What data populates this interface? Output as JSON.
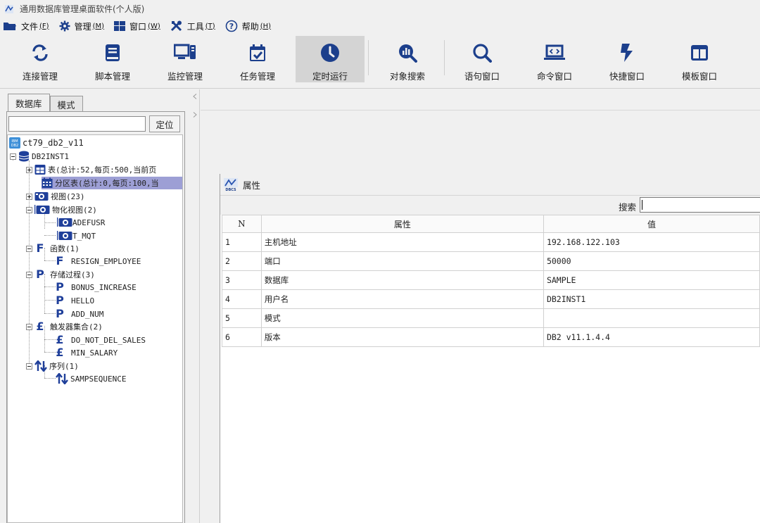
{
  "window": {
    "title": "通用数据库管理桌面软件(个人版)"
  },
  "menu": [
    {
      "label": "文件",
      "key": "(F)",
      "icon": "folder-icon"
    },
    {
      "label": "管理",
      "key": "(M)",
      "icon": "gear-icon"
    },
    {
      "label": "窗口",
      "key": "(W)",
      "icon": "windows-icon"
    },
    {
      "label": "工具",
      "key": "(T)",
      "icon": "tools-icon"
    },
    {
      "label": "帮助",
      "key": "(H)",
      "icon": "help-icon"
    }
  ],
  "toolbar": [
    {
      "label": "连接管理",
      "icon": "sync-icon"
    },
    {
      "label": "脚本管理",
      "icon": "book-icon"
    },
    {
      "label": "监控管理",
      "icon": "monitor-icon"
    },
    {
      "label": "任务管理",
      "icon": "calendar-check-icon"
    },
    {
      "label": "定时运行",
      "icon": "clock-icon",
      "active": true
    },
    {
      "label": "对象搜索",
      "icon": "chart-search-icon"
    },
    {
      "label": "语句窗口",
      "icon": "search-icon"
    },
    {
      "label": "命令窗口",
      "icon": "laptop-code-icon"
    },
    {
      "label": "快捷窗口",
      "icon": "bolt-icon"
    },
    {
      "label": "模板窗口",
      "icon": "columns-icon"
    }
  ],
  "left": {
    "tabs": [
      "数据库",
      "模式"
    ],
    "locate_button": "定位",
    "tree": {
      "root": "ct79_db2_v11",
      "instance": "DB2INST1",
      "tables": "表(总计:52,每页:500,当前页",
      "partition_tables": "分区表(总计:0,每页:100,当",
      "views": "视图(23)",
      "mviews": "物化视图(2)",
      "mview_items": [
        "ADEFUSR",
        "T_MQT"
      ],
      "functions": "函数(1)",
      "function_items": [
        "RESIGN_EMPLOYEE"
      ],
      "procedures": "存储过程(3)",
      "procedure_items": [
        "BONUS_INCREASE",
        "HELLO",
        "ADD_NUM"
      ],
      "triggers": "触发器集合(2)",
      "trigger_items": [
        "DO_NOT_DEL_SALES",
        "MIN_SALARY"
      ],
      "sequences": "序列(1)",
      "sequence_items": [
        "SAMPSEQUENCE"
      ]
    }
  },
  "properties": {
    "title": "属性",
    "search_label": "搜索",
    "columns": [
      "N",
      "属性",
      "值"
    ],
    "rows": [
      [
        "1",
        "主机地址",
        "192.168.122.103"
      ],
      [
        "2",
        "端口",
        "50000"
      ],
      [
        "3",
        "数据库",
        "SAMPLE"
      ],
      [
        "4",
        "用户名",
        "DB2INST1"
      ],
      [
        "5",
        "模式",
        ""
      ],
      [
        "6",
        "版本",
        "DB2 v11.1.4.4"
      ]
    ]
  }
}
